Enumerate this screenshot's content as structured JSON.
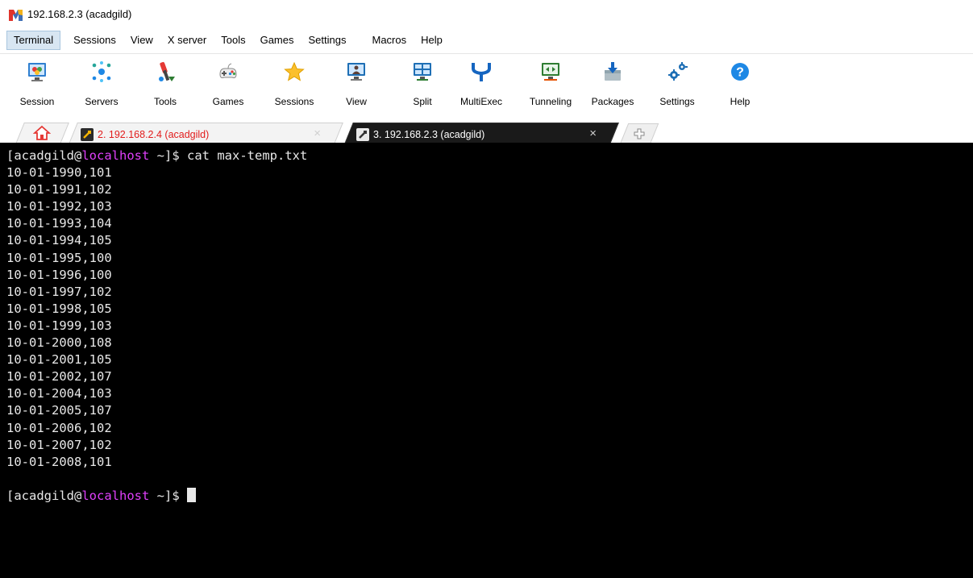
{
  "window": {
    "title": "192.168.2.3 (acadgild)",
    "logo_icon": "mobaxterm-logo-icon"
  },
  "menu": [
    {
      "label": "Terminal",
      "active": true
    },
    {
      "label": "Sessions"
    },
    {
      "label": "View"
    },
    {
      "label": "X server"
    },
    {
      "label": "Tools"
    },
    {
      "label": "Games"
    },
    {
      "label": "Settings"
    },
    {
      "label": "Macros"
    },
    {
      "label": "Help"
    }
  ],
  "toolbar": [
    {
      "label": "Session",
      "icon": "session-icon"
    },
    {
      "label": "Servers",
      "icon": "servers-icon"
    },
    {
      "label": "Tools",
      "icon": "tools-icon"
    },
    {
      "label": "Games",
      "icon": "games-icon"
    },
    {
      "label": "Sessions",
      "icon": "star-icon"
    },
    {
      "label": "View",
      "icon": "view-icon"
    },
    {
      "label": "Split",
      "icon": "split-icon"
    },
    {
      "label": "MultiExec",
      "icon": "multiexec-icon"
    },
    {
      "label": "Tunneling",
      "icon": "tunneling-icon"
    },
    {
      "label": "Packages",
      "icon": "packages-icon"
    },
    {
      "label": "Settings",
      "icon": "settings-icon"
    },
    {
      "label": "Help",
      "icon": "help-icon"
    }
  ],
  "tabs": [
    {
      "label": "2. 192.168.2.4 (acadgild)",
      "active": false,
      "close": "×"
    },
    {
      "label": "3. 192.168.2.3 (acadgild)",
      "active": true,
      "close": "×"
    }
  ],
  "colors": {
    "terminal_bg": "#000000",
    "terminal_fg": "#e8e8e8",
    "hostname": "#e040fb",
    "inactive_tab_text": "#e21c1c"
  },
  "terminal": {
    "prompt_user": "[acadgild@",
    "prompt_host": "localhost",
    "prompt_suffix": " ~]$ ",
    "command": "cat max-temp.txt",
    "output": [
      "10-01-1990,101",
      "10-01-1991,102",
      "10-01-1992,103",
      "10-01-1993,104",
      "10-01-1994,105",
      "10-01-1995,100",
      "10-01-1996,100",
      "10-01-1997,102",
      "10-01-1998,105",
      "10-01-1999,103",
      "10-01-2000,108",
      "10-01-2001,105",
      "10-01-2002,107",
      "10-01-2004,103",
      "10-01-2005,107",
      "10-01-2006,102",
      "10-01-2007,102",
      "10-01-2008,101"
    ]
  }
}
